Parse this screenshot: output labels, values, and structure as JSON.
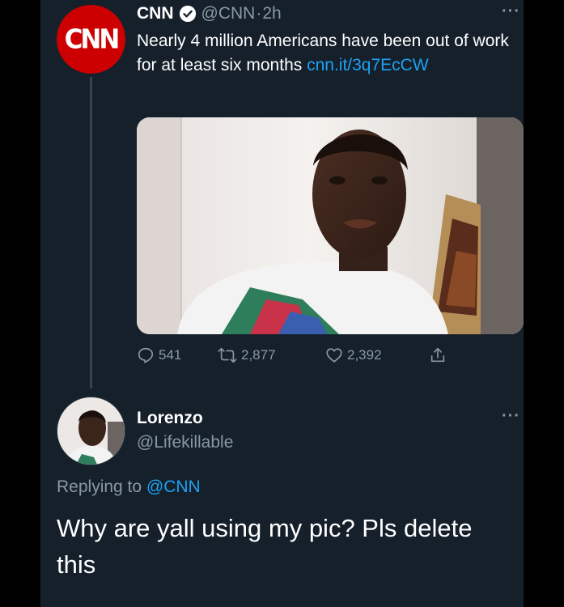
{
  "tweet": {
    "author_name": "CNN",
    "avatar_logo": "CNN",
    "handle": "@CNN",
    "separator": "·",
    "time": "2h",
    "text": "Nearly 4 million Americans have been out of work for at least six months ",
    "link_text": "cnn.it/3q7EcCW",
    "more_label": "···",
    "actions": {
      "replies": "541",
      "retweets": "2,877",
      "likes": "2,392"
    }
  },
  "reply": {
    "author_name": "Lorenzo",
    "handle": "@Lifekillable",
    "replying_prefix": "Replying to ",
    "replying_handle": "@CNN",
    "text": "Why are yall using my pic? Pls delete this",
    "more_label": "···"
  },
  "icons": [
    "verified-badge-icon",
    "more-icon",
    "reply-icon",
    "retweet-icon",
    "like-icon",
    "share-icon"
  ],
  "colors": {
    "background": "#15202b",
    "link": "#1da1f2",
    "secondary_text": "#8899a6",
    "cnn_red": "#cc0000"
  }
}
